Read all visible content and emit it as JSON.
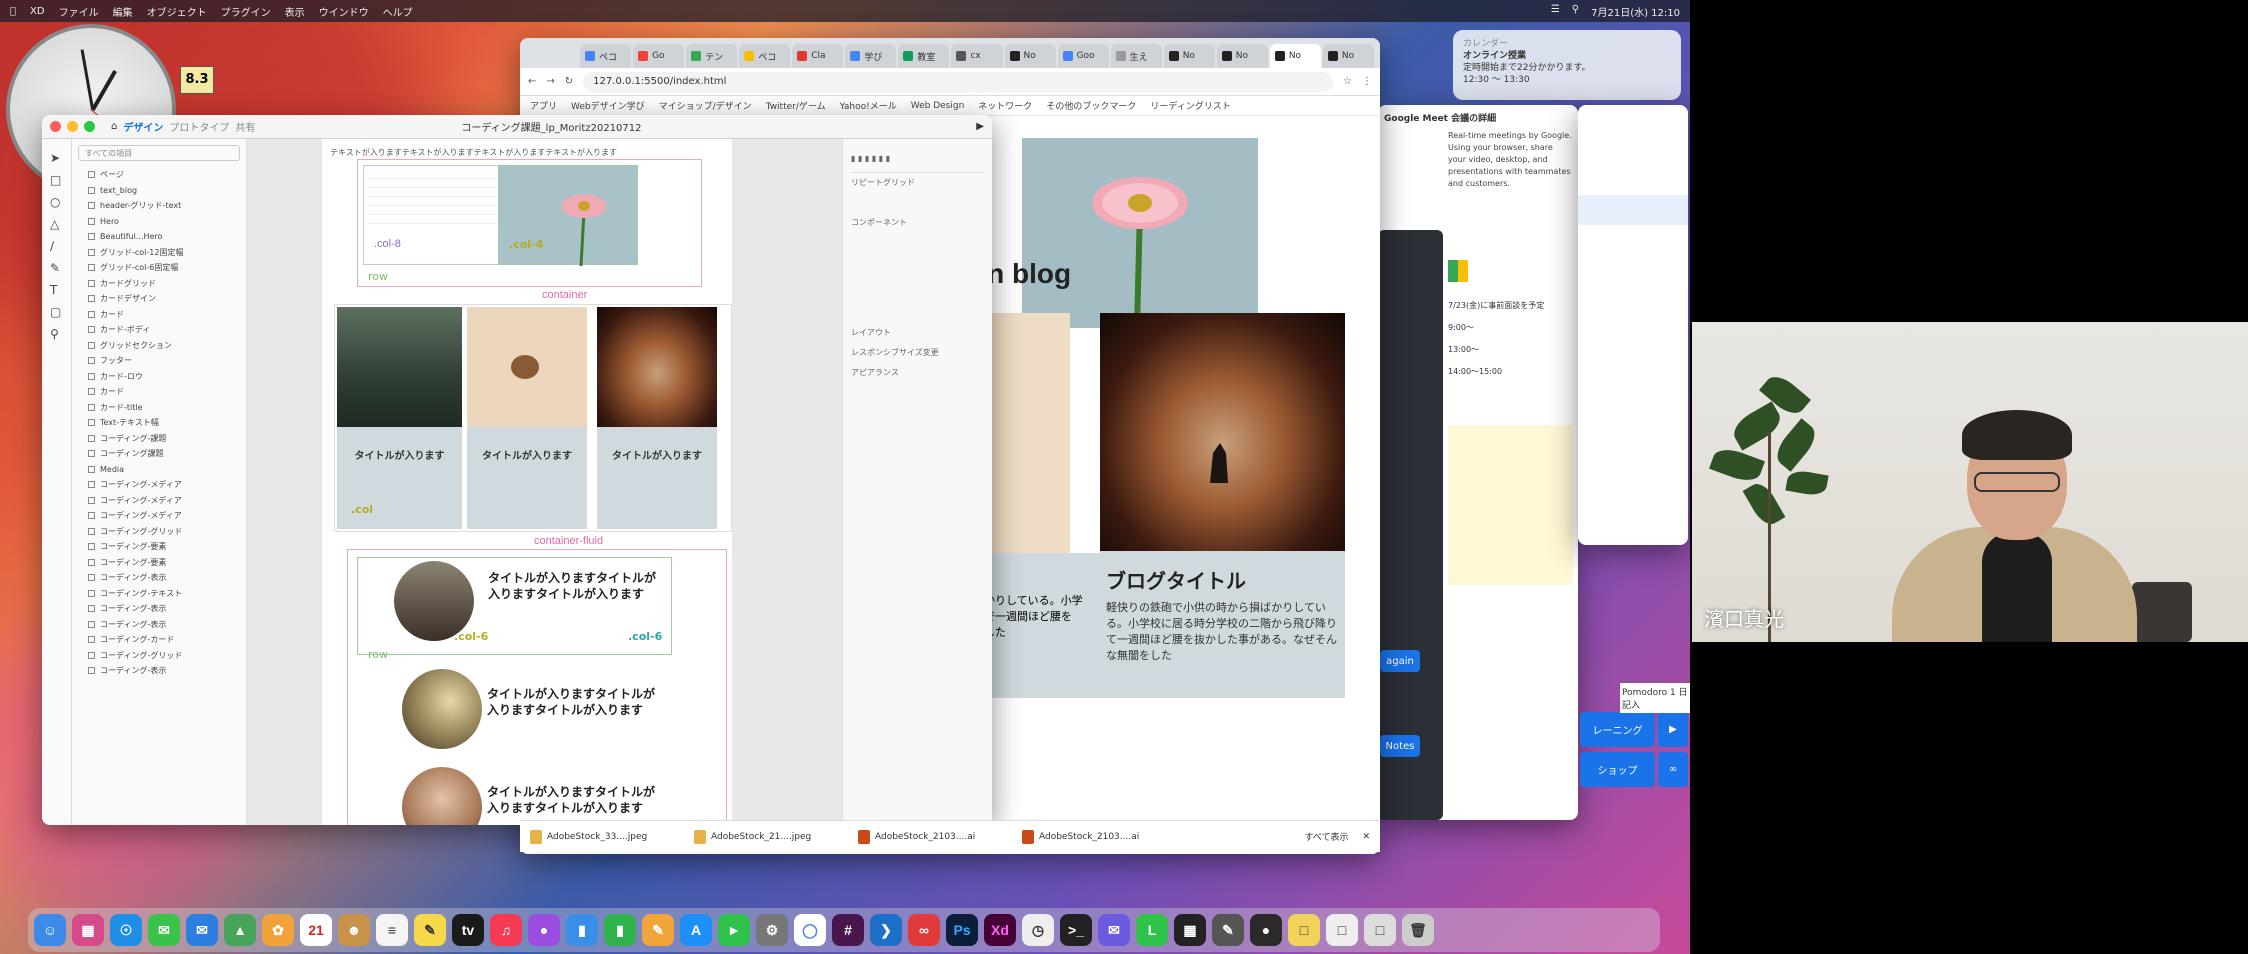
{
  "menubar": {
    "items": [
      "XD",
      "ファイル",
      "編集",
      "オブジェクト",
      "プラグイン",
      "表示",
      "ウインドウ",
      "ヘルプ"
    ],
    "clock": "7月21日(水) 12:10"
  },
  "desktop": {
    "date_badge": "8.3"
  },
  "chrome": {
    "tabs": [
      "ペコ",
      "Go",
      "テン",
      "ペコ",
      "Cla",
      "学び",
      "教室",
      "cx",
      "No",
      "Goo",
      "生え",
      "No",
      "No",
      "No",
      "No"
    ],
    "url": "127.0.0.1:5500/index.html",
    "bookmarks": [
      "アプリ",
      "Webデザイン学び",
      "マイショップ/デザイン",
      "Twitter/ゲーム",
      "Yahoo!メール",
      "Web Design",
      "ネットワーク",
      "その他のブックマーク",
      "リーディングリスト"
    ],
    "blog_heading": "gn blog",
    "card_title": "ブログタイトル",
    "card_text": "軽快りの鉄砲で小供の時から損ばかりしている。小学校に居る時分学校の二階から飛び降りて一週間ほど腰を抜かした事がある。なぜそんな無闇をした",
    "left_card_text": "かりしている。小学\nで一週間ほど腰を\nした"
  },
  "downloads": {
    "items": [
      "AdobeStock_33....jpeg",
      "AdobeStock_21....jpeg",
      "AdobeStock_2103....ai",
      "AdobeStock_2103....ai"
    ],
    "show_all": "すべて表示"
  },
  "xd": {
    "title": "コーディング課題_lp_Moritz20210712",
    "tabs": [
      "デザイン",
      "プロトタイプ",
      "共有"
    ],
    "search_placeholder": "すべての項目",
    "layers": [
      "ページ",
      "text_blog",
      "header-グリッド-text",
      "Hero",
      "Beautiful...Hero",
      "グリッド-col-12固定幅",
      "グリッド-col-6固定幅",
      "カードグリッド",
      "カードデザイン",
      "カード",
      "カード-ボディ",
      "グリッドセクション",
      "フッター",
      "カード-ロウ",
      "カード",
      "カード-title",
      "Text-テキスト幅",
      "コーディング-課題",
      "コーディング課題",
      "Media",
      "コーディング-メディア",
      "コーディング-メディア",
      "コーディング-メディア",
      "コーディング-グリッド",
      "コーディング-要素",
      "コーディング-要素",
      "コーディング-表示",
      "コーディング-テキスト",
      "コーディング-表示",
      "コーディング-表示",
      "コーディング-カード",
      "コーディング-グリッド",
      "コーディング-表示"
    ],
    "notes_top": "テキストが入りますテキストが入りますテキストが入りますテキストが入ります",
    "col8": ".col-8",
    "col4": ".col-4",
    "row": "row",
    "container": "container",
    "card_title": "タイトルが入ります",
    "col_label": ".col",
    "container_fluid": "container-fluid",
    "media_title": "タイトルが入りますタイトルが入りますタイトルが入ります",
    "col6a": ".col-6",
    "col6b": ".col-6",
    "media_small": "テキストが入ります",
    "props": {
      "repeat_grid": "リピートグリッド",
      "component": "コンポーネント",
      "layout": "レイアウト",
      "responsive": "レスポンシブサイズ変更",
      "appearance": "アピアランス"
    }
  },
  "right_panel": {
    "meet_heading": "Google Meet 会議の詳細",
    "meet_text": "Real-time meetings by Google. Using your browser, share your video, desktop, and presentations with teammates and customers.",
    "schedule_lines": [
      "7/23(金)に事前面談を予定",
      "9:00〜",
      "13:00〜",
      "14:00〜15:00"
    ],
    "again_btn": "again",
    "notes_btn": "Notes",
    "bottom_btn1": "レーニング",
    "bottom_btn2": "ショップ",
    "pomodoro": "Pomodoro 1 日記入"
  },
  "notification": {
    "app": "カレンダー",
    "line1": "オンライン授業",
    "line2": "定時開始まで22分かかります。",
    "line3": "12:30 〜 13:30"
  },
  "webcam": {
    "name": "濱口真光"
  }
}
